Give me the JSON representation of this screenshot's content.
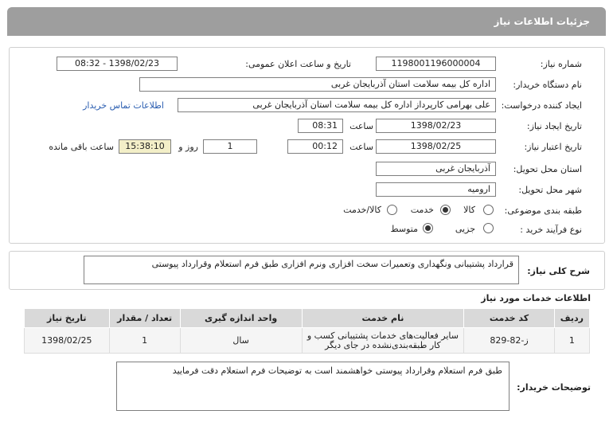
{
  "title": "جزئیات اطلاعات نیاز",
  "form": {
    "need_number_label": "شماره نیاز:",
    "need_number": "1198001196000004",
    "announce_label": "تاریخ و ساعت اعلان عمومی:",
    "announce_value": "1398/02/23 - 08:32",
    "buyer_org_label": "نام دستگاه خریدار:",
    "buyer_org": "اداره کل بیمه سلامت استان آذربایجان غربی",
    "requester_label": "ایجاد کننده درخواست:",
    "requester": "علی بهرامی کارپرداز اداره کل بیمه سلامت استان آذربایجان غربی",
    "contact_link": "اطلاعات تماس خریدار",
    "create_date_label": "تاریخ ایجاد نیاز:",
    "create_date": "1398/02/23",
    "time_label": "ساعت",
    "create_time": "08:31",
    "validity_label": "تاریخ اعتبار نیاز:",
    "validity_date": "1398/02/25",
    "validity_time": "00:12",
    "days": "1",
    "days_label": "روز و",
    "remaining": "15:38:10",
    "remaining_label": "ساعت باقی مانده",
    "province_label": "استان محل تحویل:",
    "province": "آذربایجان غربی",
    "city_label": "شهر محل تحویل:",
    "city": "ارومیه",
    "category_label": "طبقه بندی موضوعی:",
    "category_options": [
      "کالا",
      "خدمت",
      "کالا/خدمت"
    ],
    "category_selected": 1,
    "process_label": "نوع فرآیند خرید :",
    "process_options": [
      "جزیی",
      "متوسط"
    ],
    "process_selected": 1
  },
  "summary": {
    "label": "شرح کلی نیاز:",
    "text": "قرارداد پشتیبانی ونگهداری وتعمیرات سخت افزاری ونرم افزاری طبق فرم استعلام وقرارداد پیوستی"
  },
  "services": {
    "title": "اطلاعات خدمات مورد نیاز",
    "headers": [
      "ردیف",
      "کد خدمت",
      "نام خدمت",
      "واحد اندازه گیری",
      "تعداد / مقدار",
      "تاریخ نیاز"
    ],
    "rows": [
      [
        "1",
        "ز-82-829",
        "سایر فعالیت‌های خدمات پشتیبانی کسب و کار طبقه‌بندی‌نشده در جای دیگر",
        "سال",
        "1",
        "1398/02/25"
      ]
    ]
  },
  "buyer_notes": {
    "label": "توضیحات خریدار:",
    "text": "طبق فرم استعلام وقرارداد پیوستی  خواهشمند است به توضیحات فرم استعلام دقت فرمایید"
  }
}
